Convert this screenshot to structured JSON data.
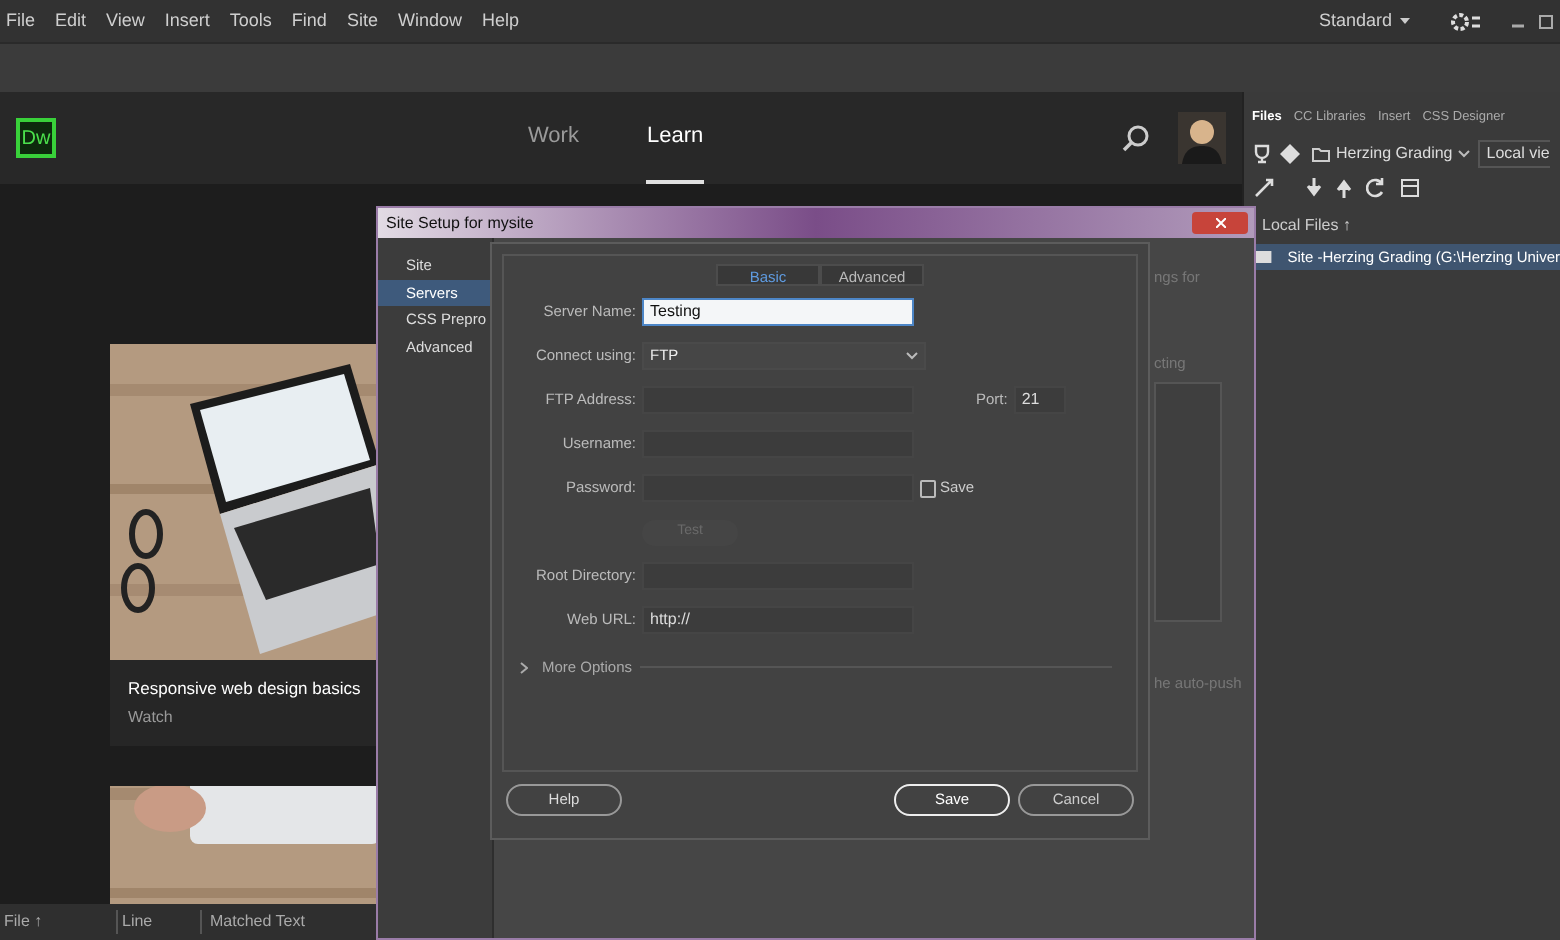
{
  "menu": [
    "File",
    "Edit",
    "View",
    "Insert",
    "Tools",
    "Find",
    "Site",
    "Window",
    "Help"
  ],
  "workspace": {
    "label": "Standard"
  },
  "logo": "Dw",
  "header_tabs": [
    {
      "label": "Work",
      "selected": false
    },
    {
      "label": "Learn",
      "selected": true
    }
  ],
  "cards": [
    {
      "kind": "video",
      "title": "Responsive web design basics",
      "subtitle": "Watch"
    },
    {
      "kind": "picture"
    }
  ],
  "results_columns": [
    "File ↑",
    "Line",
    "Matched Text"
  ],
  "panel": {
    "tabs": [
      {
        "label": "Files",
        "selected": true
      },
      {
        "label": "CC Libraries",
        "selected": false
      },
      {
        "label": "Insert",
        "selected": false
      },
      {
        "label": "CSS Designer",
        "selected": false
      }
    ],
    "site": "Herzing Grading",
    "view": "Local vie",
    "header": "Local Files ↑",
    "tree": [
      {
        "label": "Site -Herzing Grading (G:\\Herzing Univer",
        "selected": true
      }
    ]
  },
  "dialog": {
    "title": "Site Setup for mysite",
    "categories": [
      {
        "label": "Site",
        "selected": false
      },
      {
        "label": "Servers",
        "selected": true
      },
      {
        "label": "CSS Prepro",
        "selected": false
      },
      {
        "label": "Advanced",
        "selected": false
      }
    ],
    "background_texts": [
      "ngs for",
      "cting",
      "he auto-push"
    ]
  },
  "server": {
    "tabs": [
      {
        "label": "Basic",
        "selected": true
      },
      {
        "label": "Advanced",
        "selected": false
      }
    ],
    "fields": [
      {
        "kind": "text",
        "label": "Server Name:",
        "value": "Testing",
        "focused": true
      },
      {
        "kind": "select",
        "label": "Connect using:",
        "value": "FTP"
      },
      {
        "kind": "text",
        "label": "FTP Address:",
        "focused": false,
        "port_label": "Port:",
        "port_value": "21"
      },
      {
        "kind": "text",
        "label": "Username:",
        "focused": false
      },
      {
        "kind": "text",
        "label": "Password:",
        "focused": false,
        "save_label": "Save",
        "checked": false
      },
      {
        "kind": "button",
        "label": "Test",
        "disabled": true
      },
      {
        "kind": "text",
        "label": "Root Directory:",
        "focused": false
      },
      {
        "kind": "text",
        "label": "Web URL:",
        "value": "http://",
        "focused": false
      }
    ],
    "more_options": "More Options",
    "help": "Help",
    "save": "Save",
    "cancel": "Cancel"
  }
}
